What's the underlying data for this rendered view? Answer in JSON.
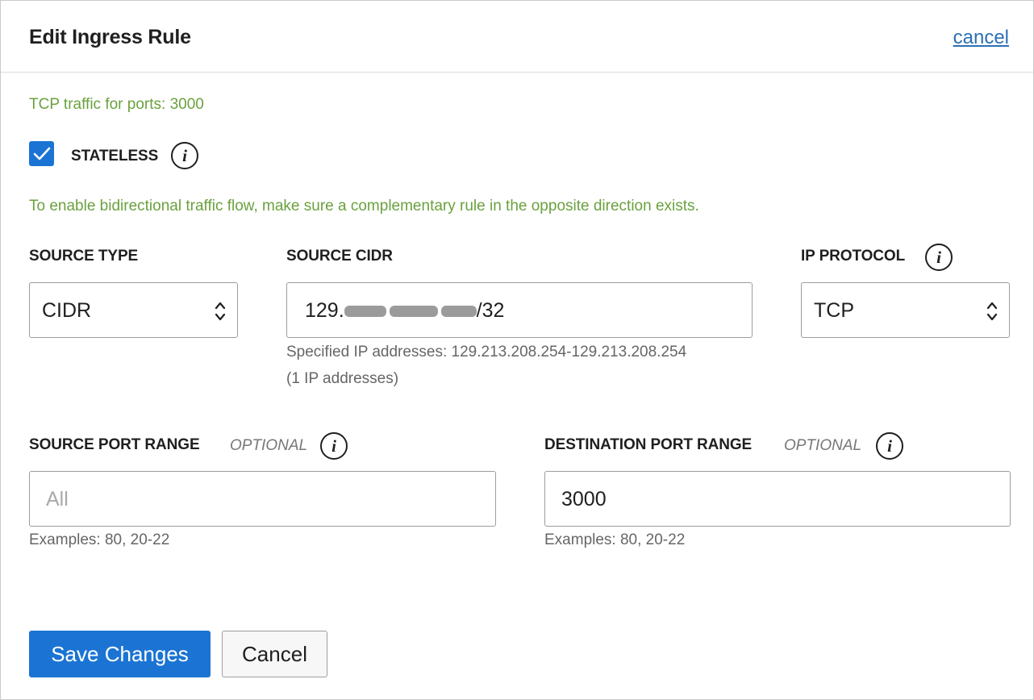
{
  "dialog": {
    "title": "Edit Ingress Rule",
    "cancel_link": "cancel"
  },
  "summary": "TCP traffic for ports: 3000",
  "stateless": {
    "checked": true,
    "label": "STATELESS",
    "info_icon": "info-icon"
  },
  "stateless_note": "To enable bidirectional traffic flow, make sure a complementary rule in the opposite direction exists.",
  "source_type": {
    "label": "SOURCE TYPE",
    "value": "CIDR"
  },
  "source_cidr": {
    "label": "SOURCE CIDR",
    "value_prefix": "129.",
    "value_suffix": "/32",
    "helper_line1": "Specified IP addresses: 129.213.208.254-129.213.208.254",
    "helper_line2": "(1 IP addresses)"
  },
  "ip_protocol": {
    "label": "IP PROTOCOL",
    "value": "TCP"
  },
  "source_port_range": {
    "label": "SOURCE PORT RANGE",
    "optional": "OPTIONAL",
    "placeholder": "All",
    "value": "",
    "helper": "Examples: 80, 20-22"
  },
  "destination_port_range": {
    "label": "DESTINATION PORT RANGE",
    "optional": "OPTIONAL",
    "value": "3000",
    "helper": "Examples: 80, 20-22"
  },
  "actions": {
    "save_label": "Save Changes",
    "cancel_label": "Cancel"
  },
  "colors": {
    "accent": "#1b74d3",
    "success_text": "#6aa13e",
    "link": "#2c6fb4"
  }
}
